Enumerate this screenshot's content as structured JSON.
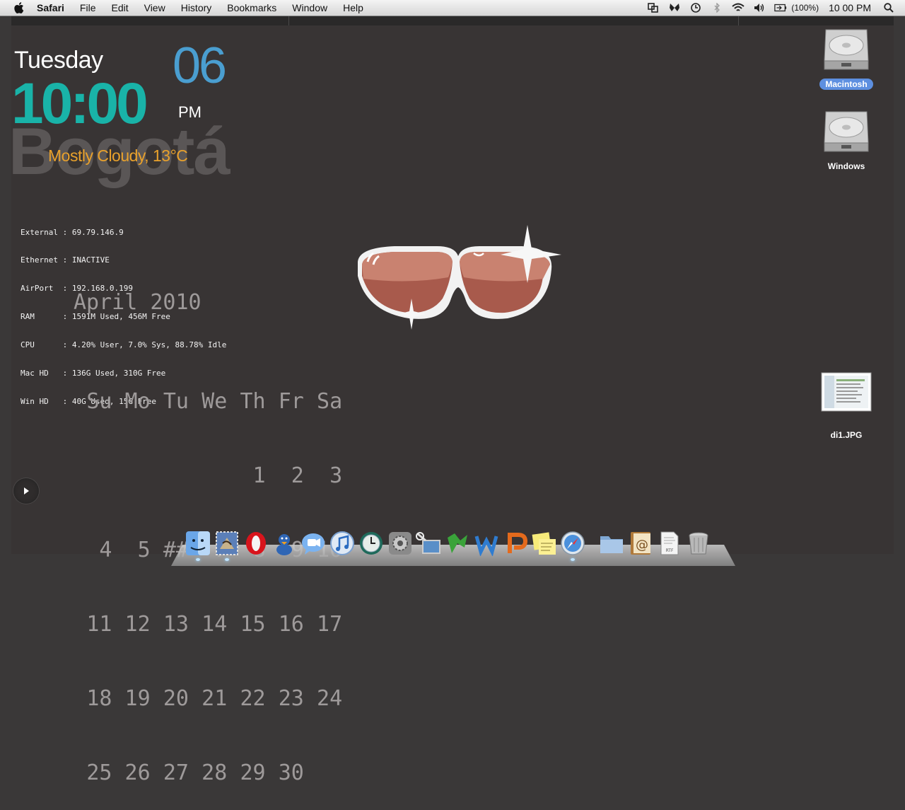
{
  "menubar": {
    "app_name": "Safari",
    "items": [
      "File",
      "Edit",
      "View",
      "History",
      "Bookmarks",
      "Window",
      "Help"
    ],
    "battery_percent": "(100%)",
    "clock": "10 00 PM"
  },
  "clock_widget": {
    "day": "Tuesday",
    "time": "10:00",
    "date": "06",
    "ampm": "PM",
    "city": "Bogotá",
    "weather": "Mostly Cloudy, 13°C"
  },
  "sysinfo": [
    "External : 69.79.146.9",
    "Ethernet : INACTIVE",
    "AirPort  : 192.168.0.199",
    "RAM      : 1591M Used, 456M Free",
    "CPU      : 4.20% User, 7.0% Sys, 88.78% Idle",
    "Mac HD   : 136G Used, 310G Free",
    "Win HD   : 40G Used, 15G Free"
  ],
  "calendar": {
    "title": "April 2010",
    "weekdays": [
      "Su",
      "Mo",
      "Tu",
      "We",
      "Th",
      "Fr",
      "Sa"
    ],
    "weeks": [
      [
        "",
        "",
        "",
        "",
        "1",
        "2",
        "3"
      ],
      [
        "4",
        "5",
        "##",
        "7",
        "8",
        "9",
        "10"
      ],
      [
        "11",
        "12",
        "13",
        "14",
        "15",
        "16",
        "17"
      ],
      [
        "18",
        "19",
        "20",
        "21",
        "22",
        "23",
        "24"
      ],
      [
        "25",
        "26",
        "27",
        "28",
        "29",
        "30",
        ""
      ]
    ]
  },
  "desktop_icons": {
    "macintosh": "Macintosh",
    "windows": "Windows",
    "di1": "di1.JPG"
  },
  "dock": {
    "items": [
      {
        "name": "finder",
        "icon": "finder-icon",
        "running": true
      },
      {
        "name": "mail",
        "icon": "mail-stamp-icon",
        "running": true
      },
      {
        "name": "opera",
        "icon": "opera-icon",
        "running": false
      },
      {
        "name": "adium",
        "icon": "duck-icon",
        "running": false
      },
      {
        "name": "ichat",
        "icon": "ichat-icon",
        "running": false
      },
      {
        "name": "itunes",
        "icon": "itunes-icon",
        "running": false
      },
      {
        "name": "time-machine",
        "icon": "time-machine-icon",
        "running": false
      },
      {
        "name": "system-preferences",
        "icon": "gear-icon",
        "running": false
      },
      {
        "name": "remote-desktop",
        "icon": "satellite-icon",
        "running": false
      },
      {
        "name": "excel",
        "icon": "excel-icon",
        "running": false
      },
      {
        "name": "word",
        "icon": "word-icon",
        "running": false
      },
      {
        "name": "powerpoint",
        "icon": "powerpoint-icon",
        "running": false
      },
      {
        "name": "stickies",
        "icon": "stickies-icon",
        "running": false
      },
      {
        "name": "safari",
        "icon": "safari-compass-icon",
        "running": true
      },
      {
        "name": "applications-folder",
        "icon": "folder-icon",
        "running": false
      },
      {
        "name": "address-book",
        "icon": "address-book-icon",
        "running": false
      },
      {
        "name": "rtf-document",
        "icon": "rtf-document-icon",
        "running": false
      },
      {
        "name": "trash",
        "icon": "trash-icon",
        "running": false
      }
    ]
  },
  "colors": {
    "desktop": "#383434",
    "time": "#19b3a8",
    "date": "#4a9ed0",
    "weather": "#e8a12c",
    "city": "#5a5656",
    "calendar": "#9e9a9a",
    "lens": "#b86a5a"
  }
}
